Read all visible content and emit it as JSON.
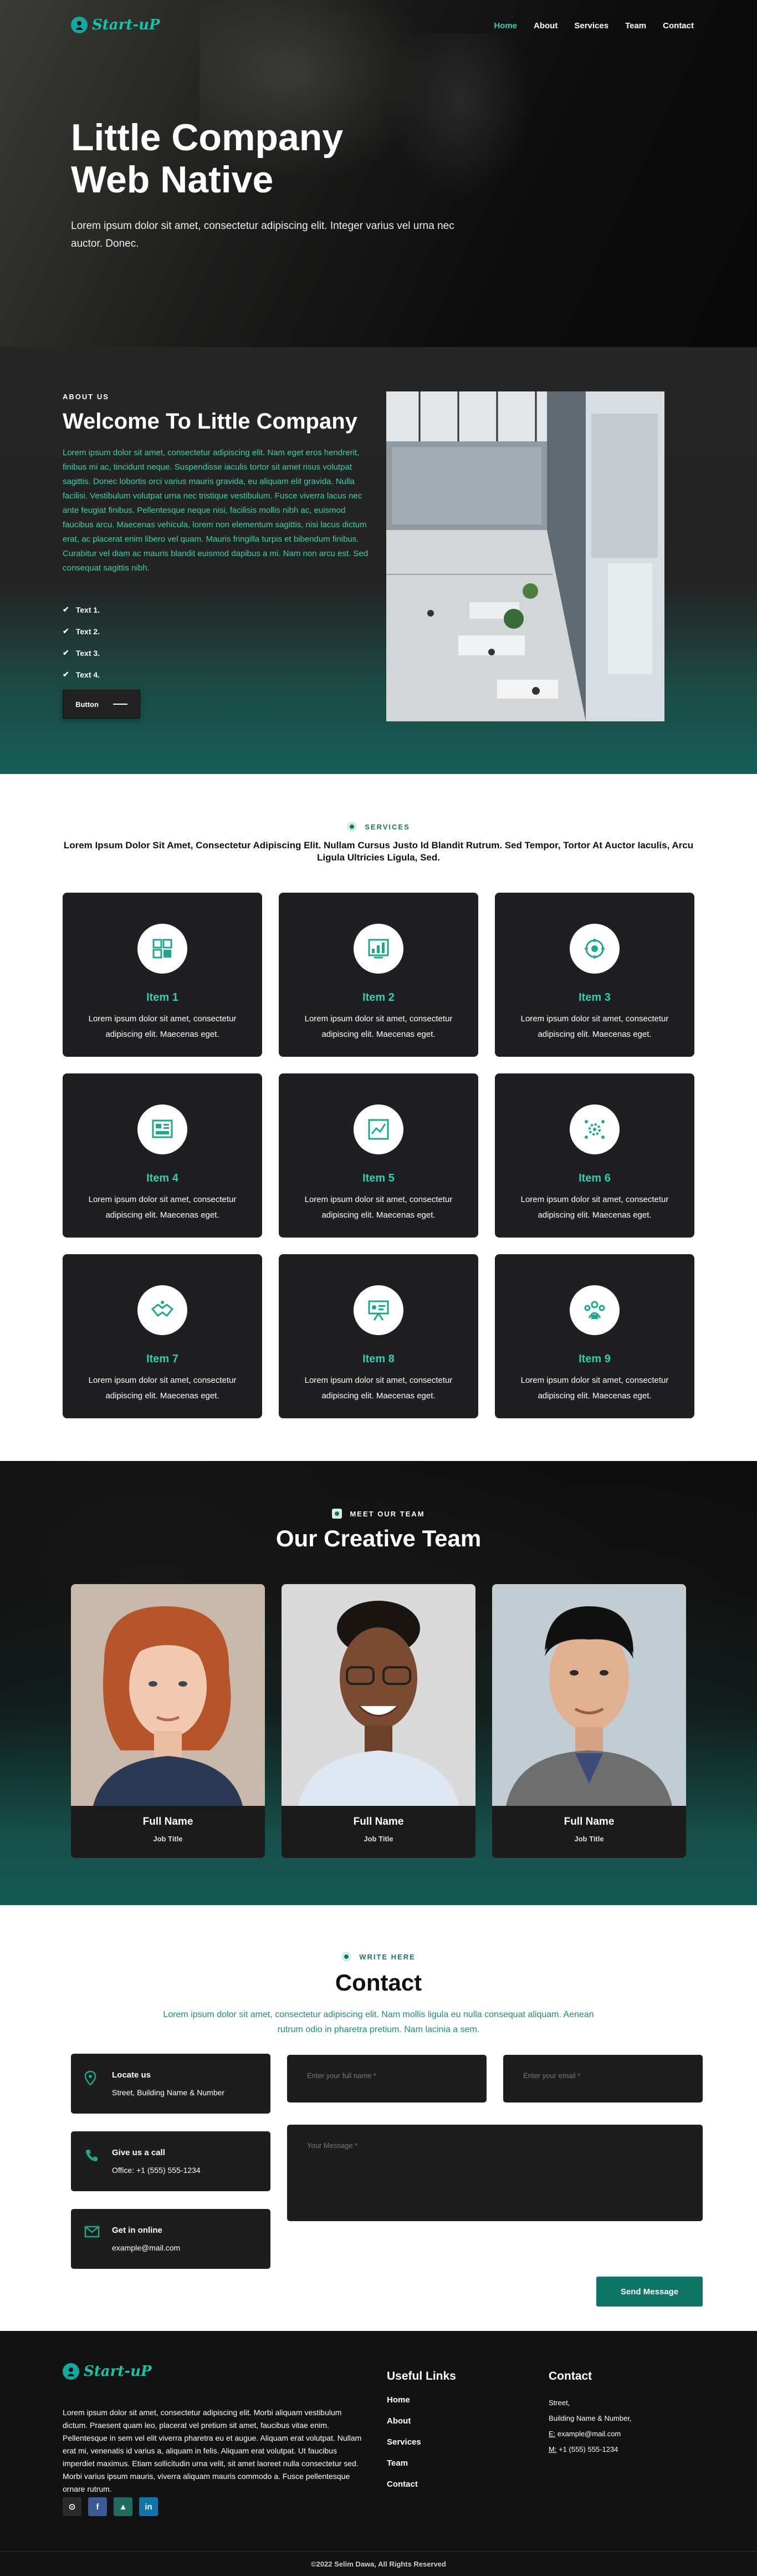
{
  "colors": {
    "accent": "#29d0b0",
    "brand_dark": "#0f7566",
    "card_bg": "#1f1f21"
  },
  "header": {
    "logo_text": "Start-uP",
    "nav": [
      {
        "label": "Home",
        "active": true
      },
      {
        "label": "About"
      },
      {
        "label": "Services"
      },
      {
        "label": "Team"
      },
      {
        "label": "Contact"
      }
    ]
  },
  "hero": {
    "title_line1": "Little Company",
    "title_line2": "Web Native",
    "subtitle": "Lorem ipsum dolor sit amet, consectetur adipiscing elit. Integer varius vel urna nec auctor. Donec."
  },
  "about": {
    "eyebrow": "ABOUT US",
    "title": "Welcome To Little Company",
    "text": "Lorem ipsum dolor sit amet, consectetur adipiscing elit. Nam eget eros hendrerit, finibus mi ac, tincidunt neque. Suspendisse iaculis tortor sit amet risus volutpat sagittis. Donec lobortis orci varius mauris gravida, eu aliquam elit gravida. Nulla facilisi. Vestibulum volutpat urna nec tristique vestibulum. Fusce viverra lacus nec ante feugiat finibus. Pellentesque neque nisi, facilisis mollis nibh ac, euismod faucibus arcu. Maecenas vehicula, lorem non elementum sagittis, nisi lacus dictum erat, ac placerat enim libero vel quam. Mauris fringilla turpis et bibendum finibus. Curabitur vel diam ac mauris blandit euismod dapibus a mi. Nam non arcu est. Sed consequat sagittis nibh.",
    "list": [
      "Text 1.",
      "Text 2.",
      "Text 3.",
      "Text 4."
    ],
    "button": "Button"
  },
  "services": {
    "eyebrow": "SERVICES",
    "description": "Lorem Ipsum Dolor Sit Amet, Consectetur Adipiscing Elit. Nullam Cursus Justo Id Blandit Rutrum. Sed Tempor, Tortor At Auctor Iaculis, Arcu Ligula Ultricies Ligula, Sed.",
    "items": [
      {
        "title": "Item 1",
        "text": "Lorem ipsum dolor sit amet, consectetur adipiscing elit. Maecenas eget.",
        "icon": "puzzle-icon"
      },
      {
        "title": "Item 2",
        "text": "Lorem ipsum dolor sit amet, consectetur adipiscing elit. Maecenas eget.",
        "icon": "analytics-icon"
      },
      {
        "title": "Item 3",
        "text": "Lorem ipsum dolor sit amet, consectetur adipiscing elit. Maecenas eget.",
        "icon": "strategy-icon"
      },
      {
        "title": "Item 4",
        "text": "Lorem ipsum dolor sit amet, consectetur adipiscing elit. Maecenas eget.",
        "icon": "dashboard-icon"
      },
      {
        "title": "Item 5",
        "text": "Lorem ipsum dolor sit amet, consectetur adipiscing elit. Maecenas eget.",
        "icon": "report-icon"
      },
      {
        "title": "Item 6",
        "text": "Lorem ipsum dolor sit amet, consectetur adipiscing elit. Maecenas eget.",
        "icon": "gear-network-icon"
      },
      {
        "title": "Item 7",
        "text": "Lorem ipsum dolor sit amet, consectetur adipiscing elit. Maecenas eget.",
        "icon": "handshake-icon"
      },
      {
        "title": "Item 8",
        "text": "Lorem ipsum dolor sit amet, consectetur adipiscing elit. Maecenas eget.",
        "icon": "presentation-icon"
      },
      {
        "title": "Item 9",
        "text": "Lorem ipsum dolor sit amet, consectetur adipiscing elit. Maecenas eget.",
        "icon": "team-icon"
      }
    ]
  },
  "team": {
    "eyebrow": "MEET OUR TEAM",
    "title": "Our Creative Team",
    "members": [
      {
        "name": "Full Name",
        "job": "Job Title"
      },
      {
        "name": "Full Name",
        "job": "Job Title"
      },
      {
        "name": "Full Name",
        "job": "Job Title"
      }
    ]
  },
  "contact": {
    "eyebrow": "WRITE HERE",
    "title": "Contact",
    "intro": "Lorem ipsum dolor sit amet, consectetur adipiscing elit. Nam mollis ligula eu nulla consequat aliquam. Aenean rutrum odio in pharetra pretium. Nam lacinia a sem.",
    "locate_label": "Locate us",
    "locate_value": "Street, Building Name & Number",
    "call_label": "Give us a call",
    "call_value": "Office: +1 (555) 555-1234",
    "mail_label": "Get in online",
    "mail_value": "example@mail.com",
    "name_placeholder": "Enter your full name *",
    "email_placeholder": "Enter your email *",
    "message_placeholder": "Your Message *",
    "send": "Send Message"
  },
  "footer": {
    "logo_text": "Start-uP",
    "about": "Lorem ipsum dolor sit amet, consectetur adipiscing elit. Morbi aliquam vestibulum dictum. Praesent quam leo, placerat vel pretium sit amet, faucibus vitae enim. Pellentesque in sem vel elit viverra pharetra eu et augue. Aliquam erat volutpat. Nullam erat mi, venenatis id varius a, aliquam in felis. Aliquam erat volutpat. Ut faucibus imperdiet maximus. Etiam sollicitudin urna velit, sit amet laoreet nulla consectetur sed. Morbi varius ipsum mauris, viverra aliquam mauris commodo a. Fusce pellentesque ornare rutrum.",
    "useful_title": "Useful Links",
    "links": [
      "Home",
      "About",
      "Services",
      "Team",
      "Contact"
    ],
    "contact_title": "Contact",
    "street": "Street,",
    "building": "Building Name & Number,",
    "email_prefix": "E:",
    "email": "example@mail.com",
    "phone_prefix": "M:",
    "phone": "+1 (555) 555-1234",
    "copyright": "©2022 Selim Dawa, All Rights Reserved"
  }
}
